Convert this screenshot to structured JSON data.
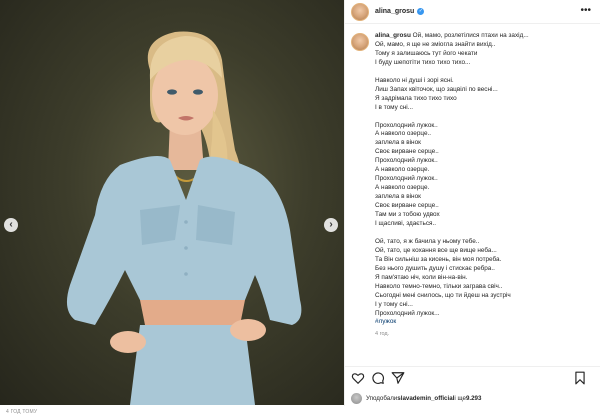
{
  "post": {
    "username": "alina_grosu",
    "verified_mark": "✓",
    "more_menu": "•••",
    "time_ago": "4 год.",
    "caption_lines": [
      "Ой, мамо, розлетілися птахи на захід...",
      "Ой, мамо, я ще не зміогла знайти вихід..",
      "Тому я залишаюсь тут його чекати",
      "І буду шепотіти тихо тихо тихо...",
      "",
      "Навколо ні душі і зорі ясні.",
      "Лиш Запах квіточок, що зацвілі по весні...",
      "Я задрімала тихо тихо тихо",
      "І в тому сні...",
      "",
      "Прохолодний лужок..",
      "А навколо озерце..",
      "заплела в вінок",
      "Своє вирване серце..",
      "Прохолодний лужок..",
      "А навколо озерце.",
      "Прохолодний лужок..",
      "А навколо озерце.",
      "заплела в вінок",
      "Своє вирване серце..",
      "Там ми з тобою удвох",
      "І щасливі, здається..",
      "",
      "Ой, тато, я ж бачила у ньому тебе..",
      "Ой, тато, це кохання все ще вище неба...",
      "Та Він сильніш за кисень, він моя потреба.",
      "Без нього душить душу і стискає ребра..",
      "Я пам'ятаю ніч, коли він-на-він.",
      "Навколо темно-темно, тільки заграва свіч..",
      "Сьогодні мені снилось, що ти йдеш на зустріч",
      "І у тому сні...",
      "Прохолодний лужок..."
    ],
    "hashtag": "#лужок"
  },
  "likes": {
    "prefix": "Уподобали ",
    "user": "slavademin_official",
    "middle": " і ще ",
    "count": "9.293"
  },
  "footer": {
    "time": "4 ГОД ТОМУ"
  },
  "photo": {
    "prev": "‹",
    "next": "›"
  },
  "colors": {
    "background_photo": "#3d3d2b",
    "shirt": "#a9c7d6",
    "hair": "#e8d0a0",
    "verified": "#3897f0",
    "hashtag": "#00376b"
  },
  "icons": [
    "heart-icon",
    "comment-icon",
    "share-icon",
    "bookmark-icon",
    "more-icon"
  ]
}
